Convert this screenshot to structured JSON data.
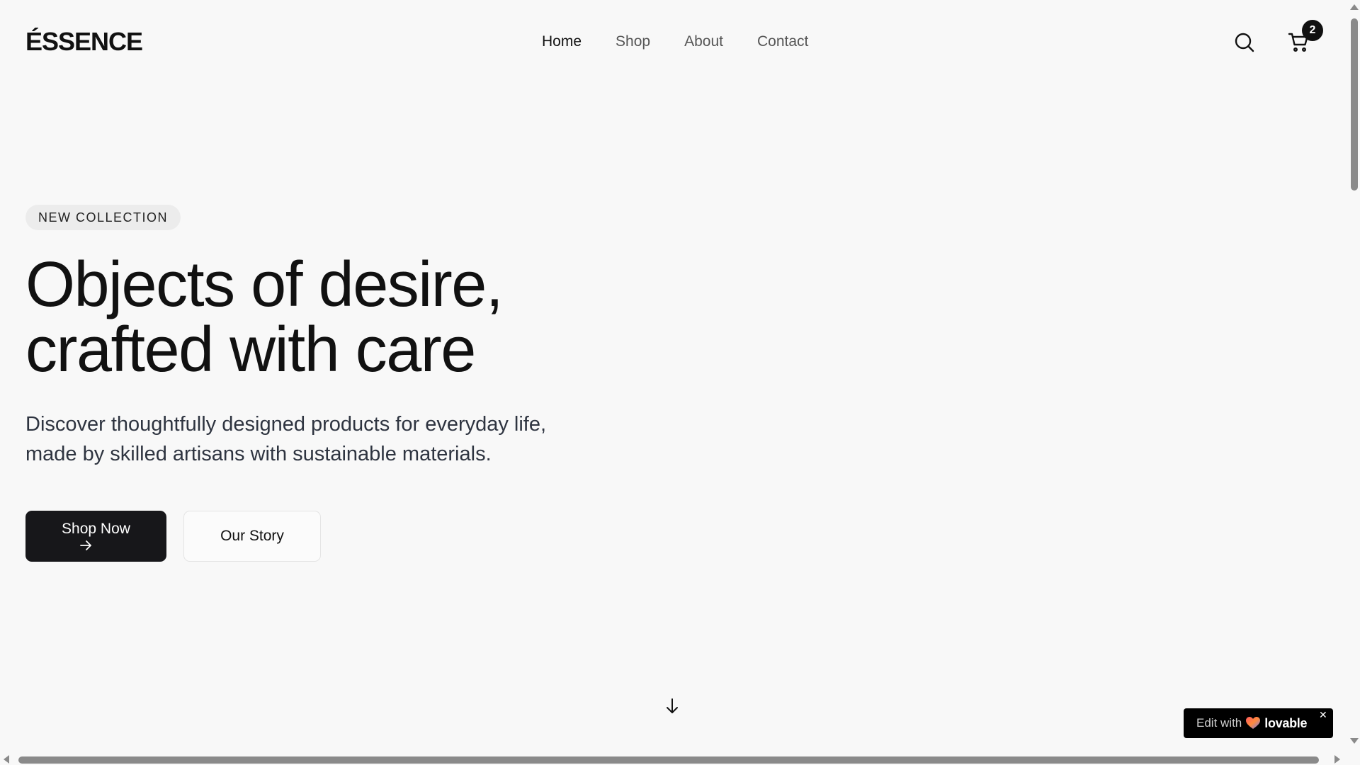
{
  "header": {
    "logo": "ÉSSENCE",
    "nav": [
      {
        "label": "Home",
        "active": true
      },
      {
        "label": "Shop",
        "active": false
      },
      {
        "label": "About",
        "active": false
      },
      {
        "label": "Contact",
        "active": false
      }
    ],
    "search_icon": "search-icon",
    "cart_icon": "cart-icon",
    "cart_count": "2"
  },
  "hero": {
    "badge": "NEW COLLECTION",
    "headline_line1": "Objects of desire,",
    "headline_line2": "crafted with care",
    "subtext_line1": "Discover thoughtfully designed products for everyday life,",
    "subtext_line2": "made by skilled artisans with sustainable materials.",
    "primary_button": "Shop Now",
    "secondary_button": "Our Story",
    "scroll_icon": "arrow-down-icon"
  },
  "lovable_badge": {
    "edit_text": "Edit with",
    "brand": "lovable",
    "close": "✕"
  },
  "colors": {
    "background": "#f8f8f8",
    "primary_button": "#17171a",
    "text": "#111111",
    "subtext": "#2e3440"
  }
}
